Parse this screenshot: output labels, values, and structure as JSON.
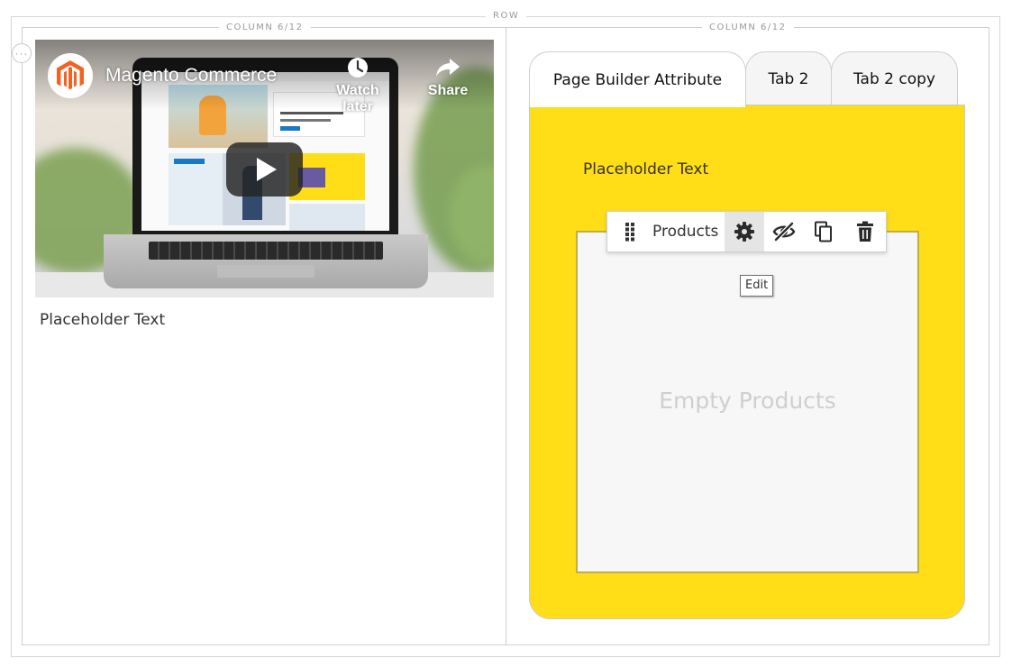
{
  "row": {
    "label": "ROW"
  },
  "columns": [
    {
      "label": "COLUMN 6/12"
    },
    {
      "label": "COLUMN 6/12"
    }
  ],
  "more_handle": {
    "icon": "more-options-icon"
  },
  "video": {
    "channel_logo_icon": "magento-logo-icon",
    "title": "Magento Commerce",
    "watch_later_label": "Watch later",
    "share_label": "Share",
    "play_icon": "play-icon",
    "brand_color": "#f26322"
  },
  "left_column": {
    "text": "Placeholder Text"
  },
  "tabs": {
    "items": [
      {
        "label": "Page Builder Attribute",
        "active": true
      },
      {
        "label": "Tab 2",
        "active": false
      },
      {
        "label": "Tab 2 copy",
        "active": false
      }
    ],
    "panel": {
      "background_color": "#ffdd17",
      "text": "Placeholder Text"
    }
  },
  "products": {
    "toolbar": {
      "drag_icon": "drag-handle-icon",
      "label": "Products",
      "edit_icon": "gear-icon",
      "hide_icon": "eye-slash-icon",
      "duplicate_icon": "copy-icon",
      "remove_icon": "trash-icon"
    },
    "tooltip": "Edit",
    "empty_text": "Empty Products"
  }
}
